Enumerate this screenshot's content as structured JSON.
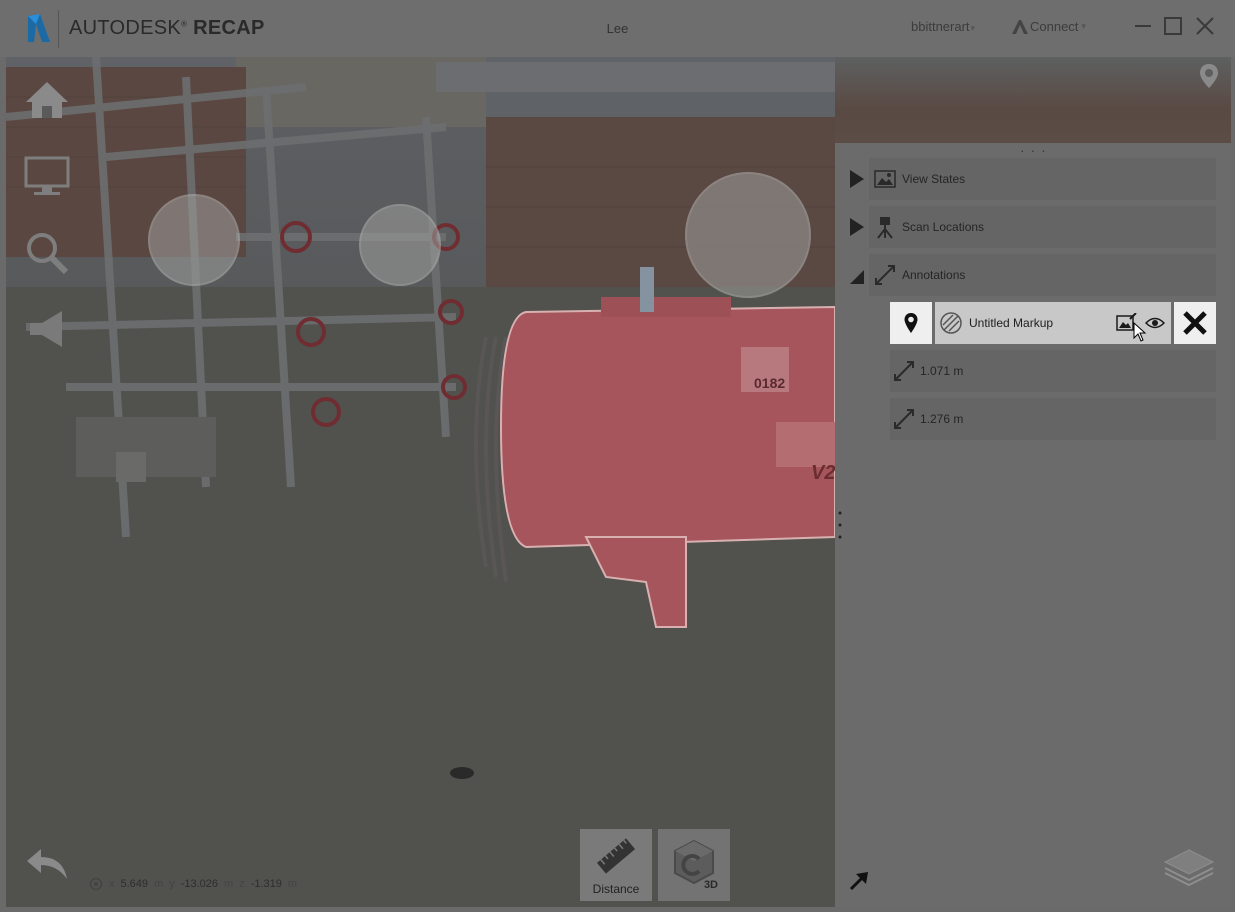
{
  "app": {
    "brand_prefix": "AUTODESK",
    "brand_product": "RECAP",
    "project_title": "Lee",
    "user": "bbittnerart",
    "connect": "Connect"
  },
  "panel": {
    "sections": [
      {
        "label": "View States",
        "expanded": false,
        "icon": "image-icon"
      },
      {
        "label": "Scan Locations",
        "expanded": false,
        "icon": "scanner-icon"
      },
      {
        "label": "Annotations",
        "expanded": true,
        "icon": "measure-icon"
      }
    ],
    "annotations": {
      "markup": {
        "label": "Untitled Markup"
      },
      "measurements": [
        {
          "label": "1.071 m"
        },
        {
          "label": "1.276 m"
        }
      ]
    }
  },
  "toolbar": {
    "distance_label": "Distance",
    "three_d_label": "3D"
  },
  "coordinates": {
    "x_label": "x",
    "x": "5.649",
    "x_unit": "m",
    "y_label": "y",
    "y": "-13.026",
    "y_unit": "m",
    "z_label": "z",
    "z": "-1.319",
    "z_unit": "m"
  },
  "scene": {
    "tank_label": "0182",
    "tank_mark": "V2"
  },
  "colors": {
    "accent_markup": "#c8c8c8",
    "tank_highlight": "#b5585f"
  }
}
